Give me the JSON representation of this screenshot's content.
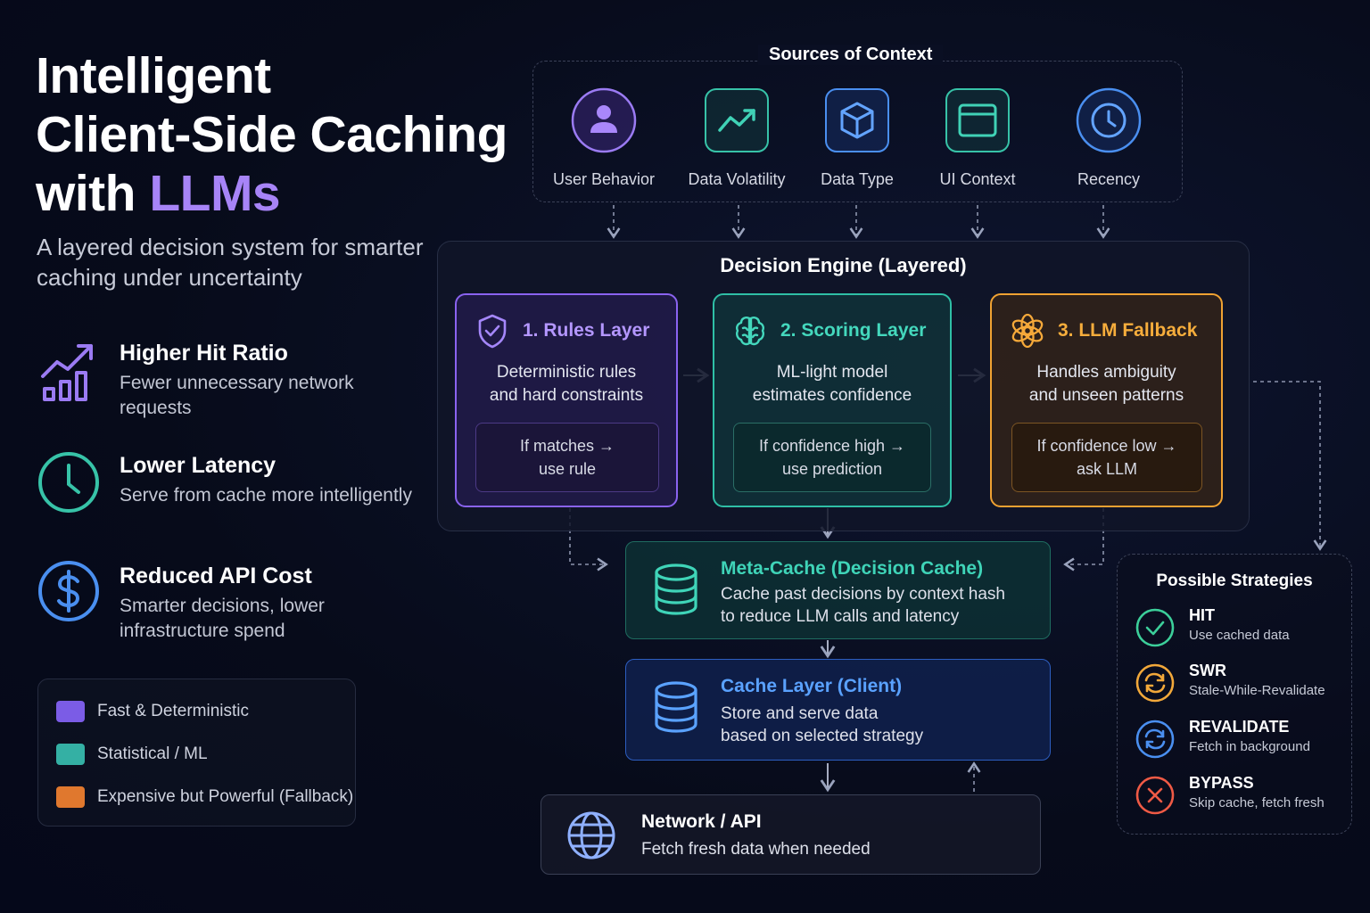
{
  "hero": {
    "title_line1": "Intelligent",
    "title_line2": "Client-Side Caching",
    "title_line3_prefix": "with ",
    "title_line3_accent": "LLMs",
    "subtitle": "A layered decision system for smarter caching under uncertainty"
  },
  "benefits": [
    {
      "icon": "bar-chart-trend-icon",
      "title": "Higher Hit Ratio",
      "desc": "Fewer unnecessary network requests"
    },
    {
      "icon": "clock-icon",
      "title": "Lower Latency",
      "desc": "Serve from cache more intelligently"
    },
    {
      "icon": "dollar-icon",
      "title": "Reduced API Cost",
      "desc": "Smarter decisions, lower infrastructure spend"
    }
  ],
  "legend": [
    {
      "label": "Fast & Deterministic",
      "color": "#7b5ce6"
    },
    {
      "label": "Statistical / ML",
      "color": "#34b0a4"
    },
    {
      "label": "Expensive but Powerful (Fallback)",
      "color": "#e0782e"
    }
  ],
  "sources": {
    "title": "Sources of Context",
    "items": [
      {
        "icon": "user-icon",
        "label": "User Behavior",
        "color": "#9b7bf3"
      },
      {
        "icon": "trend-up-icon",
        "label": "Data Volatility",
        "color": "#37c3a8"
      },
      {
        "icon": "cube-icon",
        "label": "Data Type",
        "color": "#4a8ff0"
      },
      {
        "icon": "window-icon",
        "label": "UI Context",
        "color": "#37c3a8"
      },
      {
        "icon": "clock-icon",
        "label": "Recency",
        "color": "#4a8ff0"
      }
    ]
  },
  "engine": {
    "title": "Decision Engine (Layered)",
    "layers": [
      {
        "icon": "shield-check-icon",
        "title": "1. Rules Layer",
        "desc_line1": "Deterministic rules",
        "desc_line2": "and hard constraints",
        "cond_line1": "If matches →",
        "cond_line2": "use rule"
      },
      {
        "icon": "brain-icon",
        "title": "2. Scoring Layer",
        "desc_line1": "ML-light model",
        "desc_line2": "estimates confidence",
        "cond_line1": "If confidence high →",
        "cond_line2": "use prediction"
      },
      {
        "icon": "openai-icon",
        "title": "3. LLM Fallback",
        "desc_line1": "Handles ambiguity",
        "desc_line2": "and unseen patterns",
        "cond_line1": "If confidence low →",
        "cond_line2": "ask LLM"
      }
    ]
  },
  "meta_cache": {
    "icon": "database-icon",
    "title": "Meta-Cache (Decision Cache)",
    "desc_line1": "Cache past decisions by context hash",
    "desc_line2": "to reduce LLM calls and latency",
    "title_color": "#3fd4b8"
  },
  "cache_layer": {
    "icon": "database-icon",
    "title": "Cache Layer (Client)",
    "desc_line1": "Store and serve data",
    "desc_line2": "based on selected strategy",
    "title_color": "#5aa2ff"
  },
  "network": {
    "icon": "globe-icon",
    "title": "Network / API",
    "desc": "Fetch fresh data when needed"
  },
  "strategies": {
    "title": "Possible Strategies",
    "items": [
      {
        "icon": "check-circle-icon",
        "name": "HIT",
        "desc": "Use cached data",
        "color": "#3ccf9a"
      },
      {
        "icon": "refresh-icon",
        "name": "SWR",
        "desc": "Stale-While-Revalidate",
        "color": "#f2a83a"
      },
      {
        "icon": "sync-icon",
        "name": "REVALIDATE",
        "desc": "Fetch in background",
        "color": "#4a8ff0"
      },
      {
        "icon": "x-circle-icon",
        "name": "BYPASS",
        "desc": "Skip cache, fetch fresh",
        "color": "#ef5a45"
      }
    ]
  }
}
